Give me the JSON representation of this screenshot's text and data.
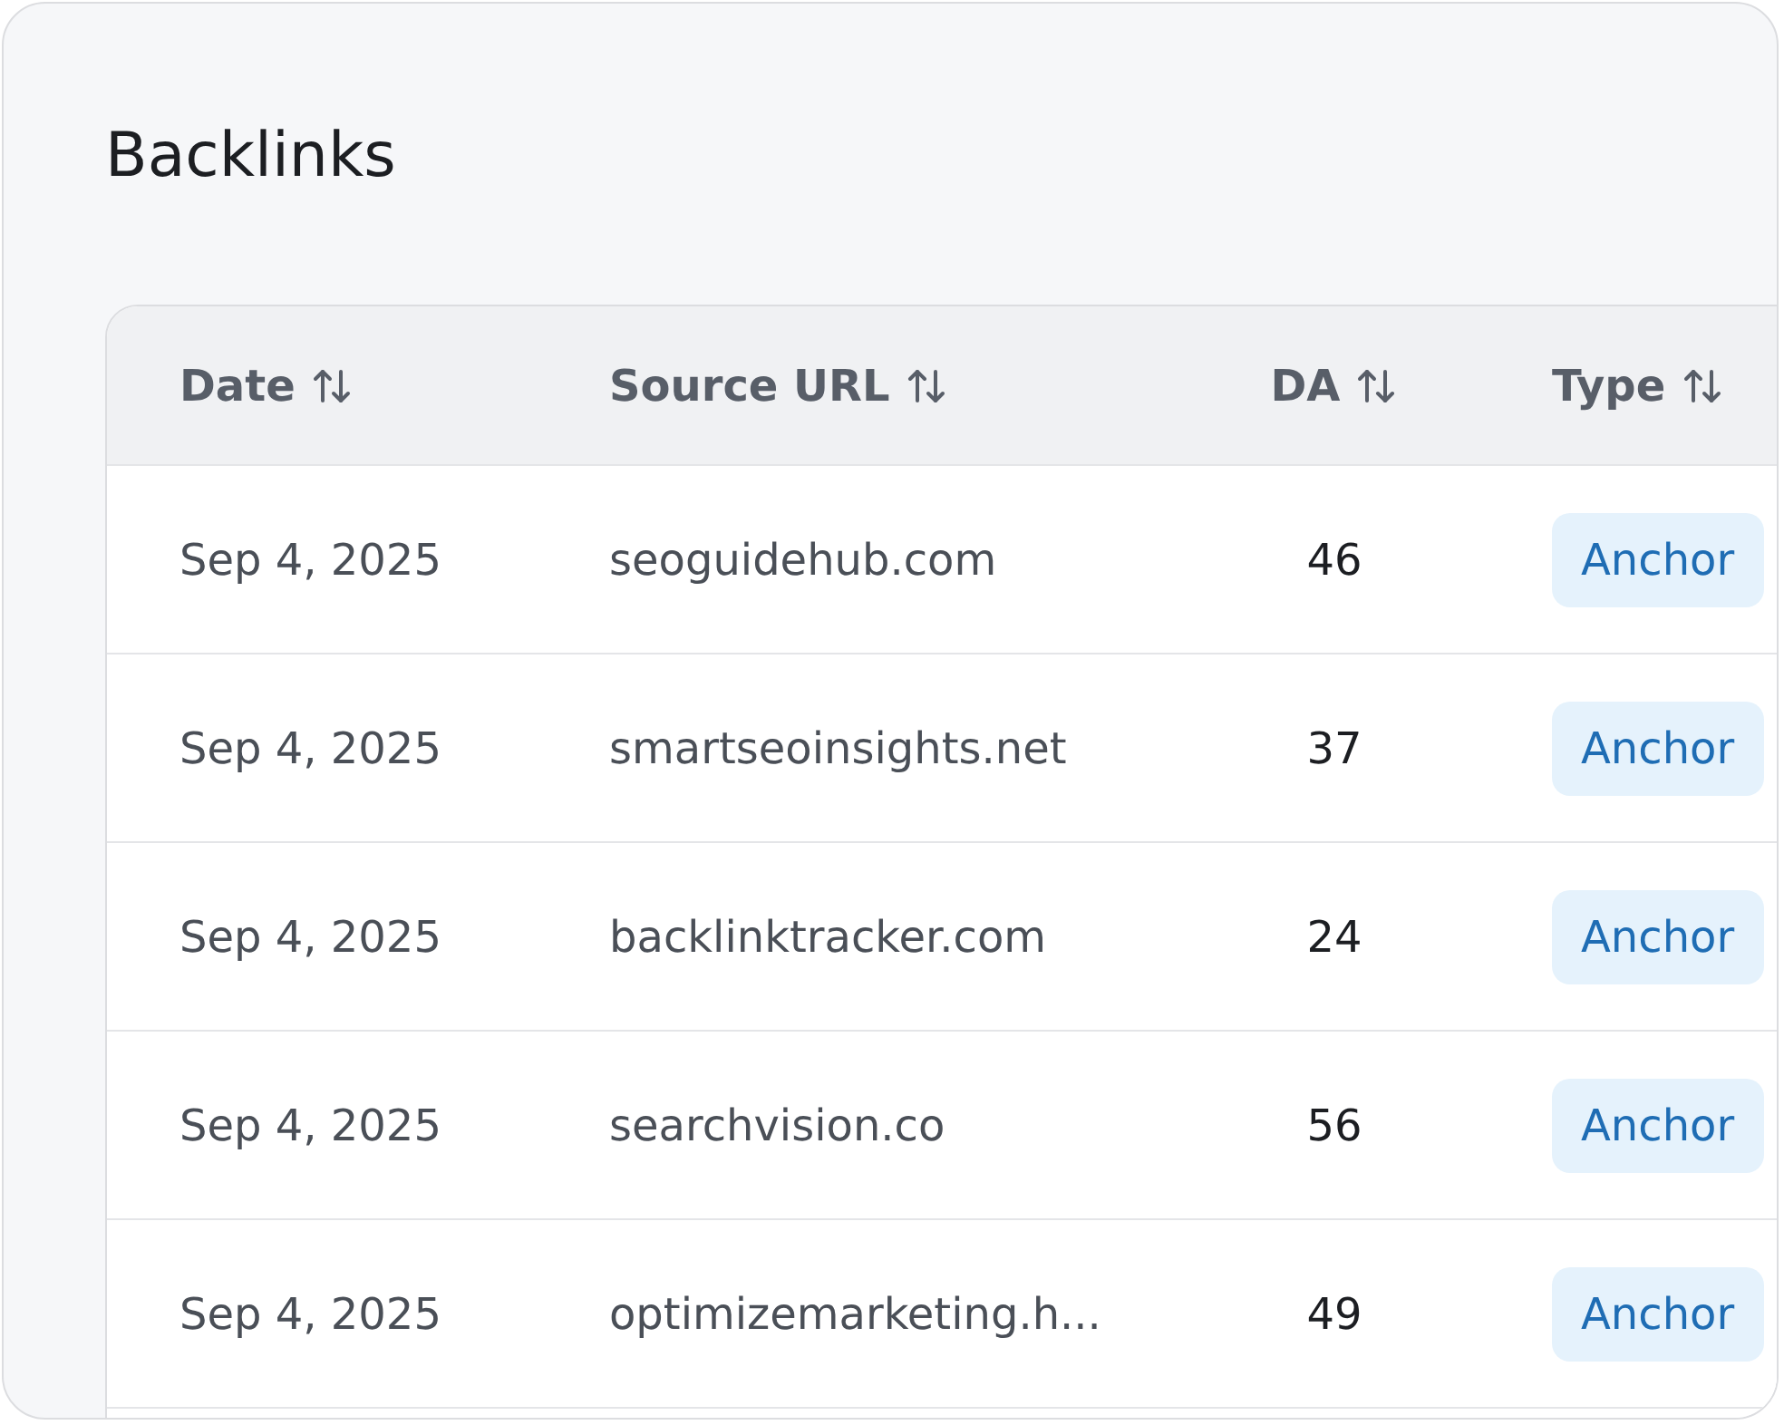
{
  "title": "Backlinks",
  "columns": [
    {
      "label": "Date"
    },
    {
      "label": "Source URL"
    },
    {
      "label": "DA"
    },
    {
      "label": "Type"
    }
  ],
  "rows": [
    {
      "date": "Sep 4, 2025",
      "source_url": "seoguidehub.com",
      "da": "46",
      "type": "Anchor"
    },
    {
      "date": "Sep 4, 2025",
      "source_url": "smartseoinsights.net",
      "da": "37",
      "type": "Anchor"
    },
    {
      "date": "Sep 4, 2025",
      "source_url": "backlinktracker.com",
      "da": "24",
      "type": "Anchor"
    },
    {
      "date": "Sep 4, 2025",
      "source_url": "searchvision.co",
      "da": "56",
      "type": "Anchor"
    },
    {
      "date": "Sep 4, 2025",
      "source_url": "optimizemarketing.h...",
      "da": "49",
      "type": "Anchor"
    }
  ]
}
